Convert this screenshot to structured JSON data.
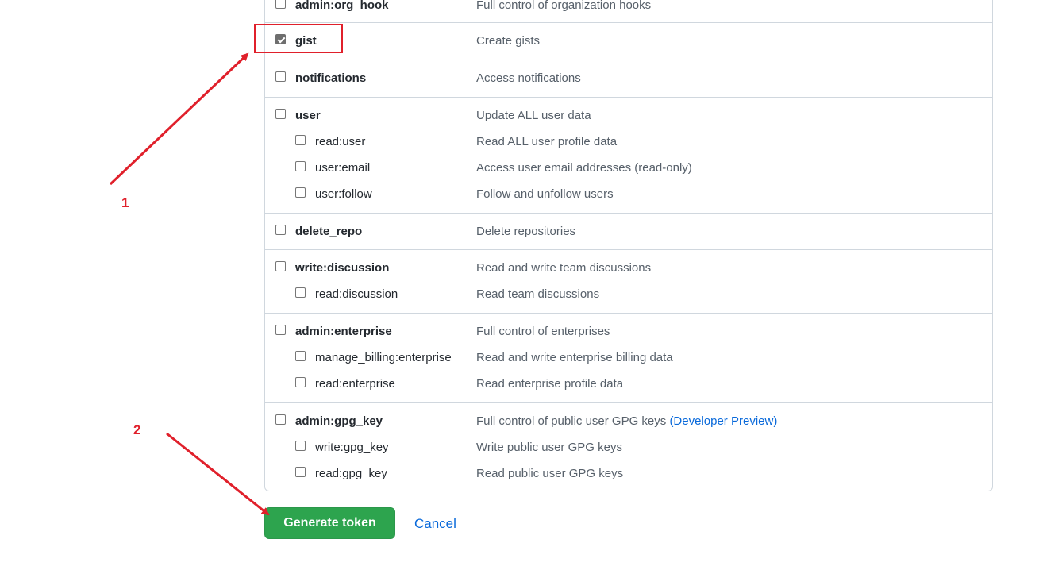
{
  "colors": {
    "accent_green": "#2da44e",
    "link_blue": "#0969da",
    "annotation_red": "#e0202b",
    "border": "#d0d7de"
  },
  "scopes": [
    {
      "name": "admin:org_hook",
      "desc": "Full control of organization hooks",
      "checked": false,
      "children": []
    },
    {
      "name": "gist",
      "desc": "Create gists",
      "checked": true,
      "children": []
    },
    {
      "name": "notifications",
      "desc": "Access notifications",
      "checked": false,
      "children": []
    },
    {
      "name": "user",
      "desc": "Update ALL user data",
      "checked": false,
      "children": [
        {
          "name": "read:user",
          "desc": "Read ALL user profile data",
          "checked": false
        },
        {
          "name": "user:email",
          "desc": "Access user email addresses (read-only)",
          "checked": false
        },
        {
          "name": "user:follow",
          "desc": "Follow and unfollow users",
          "checked": false
        }
      ]
    },
    {
      "name": "delete_repo",
      "desc": "Delete repositories",
      "checked": false,
      "children": []
    },
    {
      "name": "write:discussion",
      "desc": "Read and write team discussions",
      "checked": false,
      "children": [
        {
          "name": "read:discussion",
          "desc": "Read team discussions",
          "checked": false
        }
      ]
    },
    {
      "name": "admin:enterprise",
      "desc": "Full control of enterprises",
      "checked": false,
      "children": [
        {
          "name": "manage_billing:enterprise",
          "desc": "Read and write enterprise billing data",
          "checked": false
        },
        {
          "name": "read:enterprise",
          "desc": "Read enterprise profile data",
          "checked": false
        }
      ]
    },
    {
      "name": "admin:gpg_key",
      "desc": "Full control of public user GPG keys",
      "desc_link": "(Developer Preview)",
      "checked": false,
      "children": [
        {
          "name": "write:gpg_key",
          "desc": "Write public user GPG keys",
          "checked": false
        },
        {
          "name": "read:gpg_key",
          "desc": "Read public user GPG keys",
          "checked": false
        }
      ]
    }
  ],
  "actions": {
    "generate_label": "Generate token",
    "cancel_label": "Cancel"
  },
  "annotations": {
    "step1": "1",
    "step2": "2"
  }
}
